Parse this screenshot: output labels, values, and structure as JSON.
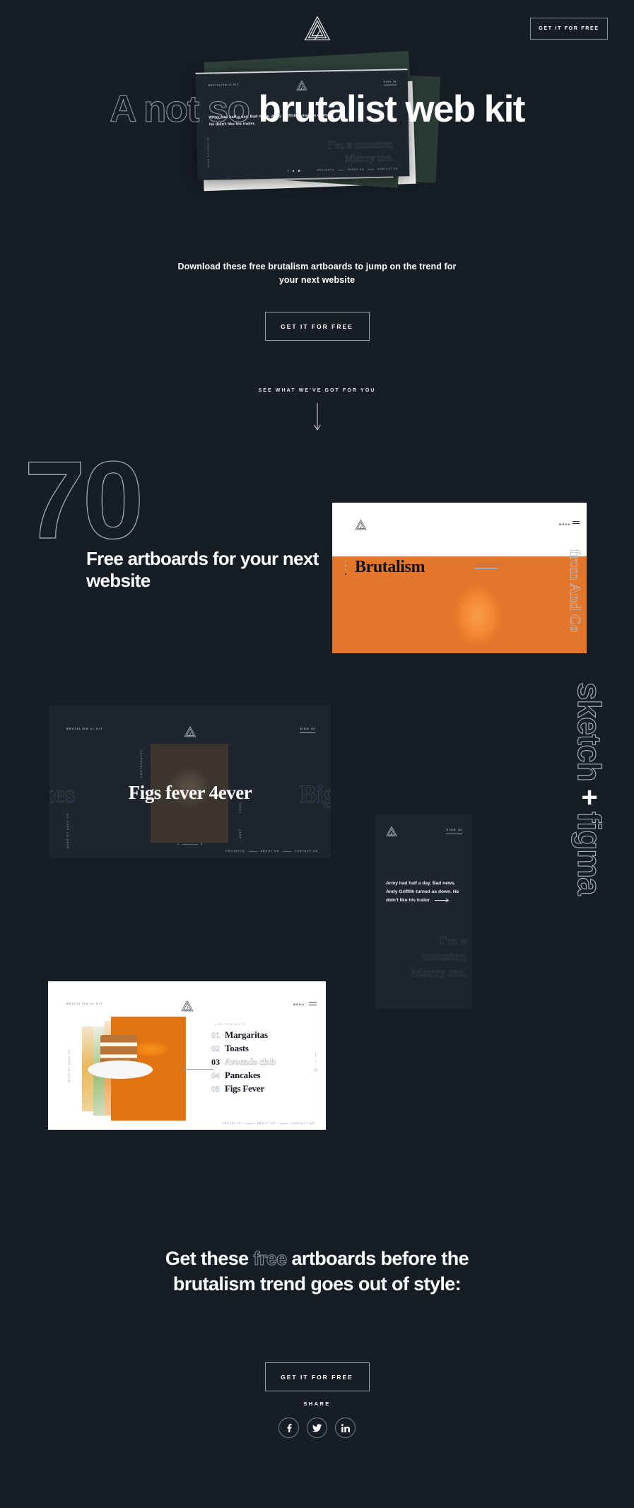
{
  "theme": {
    "background": "#161d24",
    "text": "#ffffff",
    "outline": "#9aa2ad",
    "card_dark": "#1e252e",
    "card_light": "#ffffff",
    "accent_green": "#2e4138",
    "accent_orange": "#ef7f12"
  },
  "header": {
    "logo_icon": "penrose-triangle-logo",
    "cta_label": "GET IT FOR FREE"
  },
  "hero": {
    "title_outline": "A not so",
    "title_solid": "brutalist web kit",
    "subtitle": "Download these free brutalism artboards to jump on the trend for your next website",
    "cta_label": "GET IT FOR FREE",
    "scroll_hint": "SEE WHAT WE'VE GOT FOR YOU",
    "scroll_icon": "down-arrow-icon",
    "mockup": {
      "brand": "BRUTALISM UI KIT",
      "signin": "SIGN IN",
      "paragraph": "Army had half a day. Bad news. Andy Griffith turned us down. He didn't like his trailer.",
      "ghost_line1": "I'm a monster,",
      "ghost_line2": "Marry me.",
      "nav": [
        "PROJECTS",
        "ABOUT US",
        "CONTACT US"
      ],
      "side_label": "MADE BY ANDS CO",
      "social": [
        "f",
        "t",
        "in"
      ]
    }
  },
  "stats": {
    "number": "70",
    "headline": "Free artboards for your next website"
  },
  "card_brutalism": {
    "logo_icon": "penrose-triangle-logo",
    "menu_label": "MENU",
    "burger_icon": "hamburger-menu-icon",
    "title": "Brutalism",
    "access_label": "ACCESS NOW",
    "side_text": "from And Co"
  },
  "card_figs": {
    "brand": "BRUTALISM UI KIT",
    "signin": "SIGN IN",
    "logo_icon": "penrose-triangle-logo",
    "title": "Figs fever 4ever",
    "ghost_left": "kes",
    "ghost_right": "Big",
    "label_photography": "PHOTOGRAPHY",
    "label_made_by": "MADE BY ANDS CO",
    "label_next": "NEXT",
    "label_food": "FOOD",
    "pager_from": "1",
    "pager_to": "5",
    "nav": [
      "PROJECTS",
      "ABOUT US",
      "CONTACT US"
    ]
  },
  "card_mobile": {
    "logo_icon": "penrose-triangle-logo",
    "signin": "SIGN IN",
    "paragraph": "Army had half a day. Bad news. Andy Griffith turned us down. He didn't like his trailer.",
    "arrow_icon": "right-arrow-icon",
    "ghost_line1": "I'm a",
    "ghost_line2": "monster,",
    "ghost_line3": "Marry me."
  },
  "tools": {
    "word1": "sketch",
    "plus": "+",
    "word2": "figma"
  },
  "card_menu": {
    "brand": "BRUTALISM UI KIT",
    "logo_icon": "penrose-triangle-logo",
    "menu_label": "MENU",
    "burger_icon": "hamburger-menu-icon",
    "projects_label": "OUR PROJECTS",
    "side_label": "MADE BY ANDS CO",
    "items": [
      {
        "num": "01",
        "name": "Margaritas",
        "active": false
      },
      {
        "num": "02",
        "name": "Toasts",
        "active": false
      },
      {
        "num": "03",
        "name": "Avocado club",
        "active": true
      },
      {
        "num": "04",
        "name": "Pancakes",
        "active": false
      },
      {
        "num": "05",
        "name": "Figs Fever",
        "active": false
      }
    ],
    "nav": [
      "PROJECTS",
      "ABOUT US",
      "CONTACT US"
    ]
  },
  "bottom": {
    "line1_a": "Get these ",
    "line1_ghost": "free",
    "line1_b": " artboards before the",
    "line2": "brutalism trend goes out of style:",
    "cta_label": "GET IT FOR FREE"
  },
  "footer": {
    "share_label": "SHARE",
    "socials": [
      {
        "name": "facebook-icon"
      },
      {
        "name": "twitter-icon"
      },
      {
        "name": "linkedin-icon"
      }
    ]
  }
}
